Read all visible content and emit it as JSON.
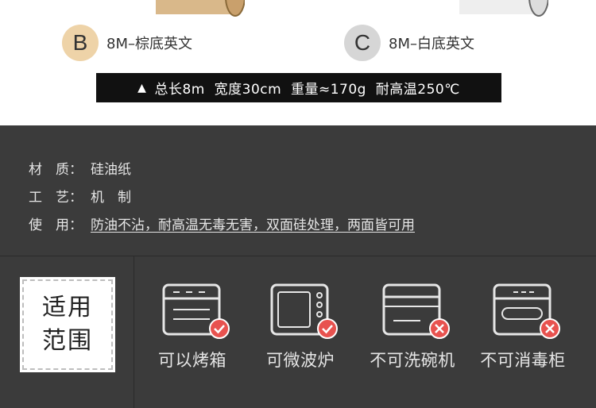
{
  "variants": [
    {
      "letter": "B",
      "label": "8M–棕底英文"
    },
    {
      "letter": "C",
      "label": "8M–白底英文"
    }
  ],
  "spec_bar": {
    "icon": "triangle-up-icon",
    "text": "总长8m  宽度30cm  重量≈170g  耐高温250℃"
  },
  "attributes": [
    {
      "label": "材　质：",
      "value": "硅油纸"
    },
    {
      "label": "工　艺：",
      "value": "机　制"
    },
    {
      "label": "使　用：",
      "value": "防油不沾，耐高温无毒无害，双面硅处理，两面皆可用"
    }
  ],
  "scope": {
    "line1": "适用",
    "line2": "范围"
  },
  "appliances": [
    {
      "label": "可以烤箱",
      "icon": "oven-icon",
      "status": "check",
      "status_icon": "check-icon"
    },
    {
      "label": "可微波炉",
      "icon": "microwave-icon",
      "status": "check",
      "status_icon": "check-icon"
    },
    {
      "label": "不可洗碗机",
      "icon": "dishwasher-icon",
      "status": "cross",
      "status_icon": "cross-icon"
    },
    {
      "label": "不可消毒柜",
      "icon": "disinfection-cabinet-icon",
      "status": "cross",
      "status_icon": "cross-icon"
    }
  ],
  "colors": {
    "dark_bg": "#3b3b3b",
    "check": "#e8524f",
    "badge_b": "#eed3a8",
    "badge_c": "#d6d6d6"
  }
}
